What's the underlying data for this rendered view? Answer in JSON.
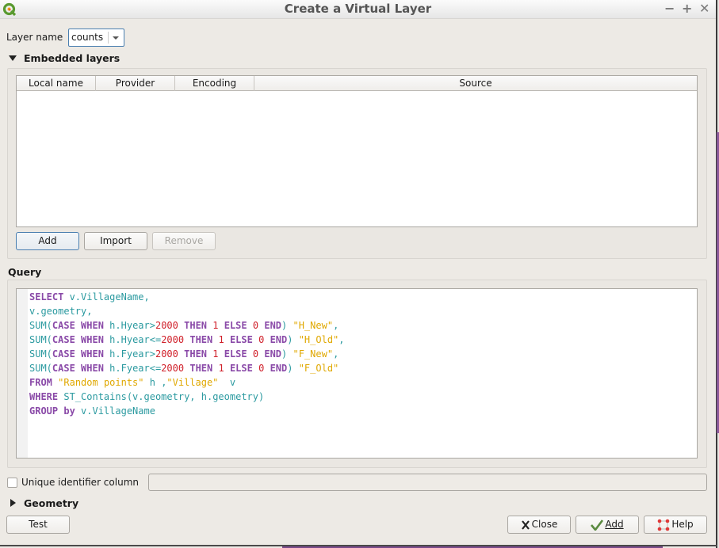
{
  "window": {
    "title": "Create a Virtual Layer",
    "app_icon": "qgis-logo-icon",
    "controls": {
      "minimize": "−",
      "maximize": "+",
      "close": "✕"
    }
  },
  "layer_name": {
    "label": "Layer name",
    "value": "counts"
  },
  "embedded_layers": {
    "title": "Embedded layers",
    "expanded": true,
    "columns": [
      "Local name",
      "Provider",
      "Encoding",
      "Source"
    ],
    "rows": [],
    "buttons": {
      "add": "Add",
      "import": "Import",
      "remove": "Remove"
    }
  },
  "query": {
    "title": "Query",
    "lines": [
      [
        [
          "kw",
          "SELECT"
        ],
        [
          "id",
          " v.VillageName,"
        ]
      ],
      [
        [
          "id",
          "v.geometry,"
        ]
      ],
      [
        [
          "id",
          "SUM("
        ],
        [
          "kw",
          "CASE"
        ],
        [
          "id",
          " "
        ],
        [
          "kw",
          "WHEN"
        ],
        [
          "id",
          " h.Hyear>"
        ],
        [
          "num",
          "2000"
        ],
        [
          "id",
          " "
        ],
        [
          "kw",
          "THEN"
        ],
        [
          "id",
          " "
        ],
        [
          "num",
          "1"
        ],
        [
          "id",
          " "
        ],
        [
          "kw",
          "ELSE"
        ],
        [
          "id",
          " "
        ],
        [
          "num",
          "0"
        ],
        [
          "id",
          " "
        ],
        [
          "kw",
          "END"
        ],
        [
          "id",
          ") "
        ],
        [
          "str",
          "\"H_New\""
        ],
        [
          "id",
          ","
        ]
      ],
      [
        [
          "id",
          "SUM("
        ],
        [
          "kw",
          "CASE"
        ],
        [
          "id",
          " "
        ],
        [
          "kw",
          "WHEN"
        ],
        [
          "id",
          " h.Hyear<="
        ],
        [
          "num",
          "2000"
        ],
        [
          "id",
          " "
        ],
        [
          "kw",
          "THEN"
        ],
        [
          "id",
          " "
        ],
        [
          "num",
          "1"
        ],
        [
          "id",
          " "
        ],
        [
          "kw",
          "ELSE"
        ],
        [
          "id",
          " "
        ],
        [
          "num",
          "0"
        ],
        [
          "id",
          " "
        ],
        [
          "kw",
          "END"
        ],
        [
          "id",
          ") "
        ],
        [
          "str",
          "\"H_Old\""
        ],
        [
          "id",
          ","
        ]
      ],
      [
        [
          "id",
          "SUM("
        ],
        [
          "kw",
          "CASE"
        ],
        [
          "id",
          " "
        ],
        [
          "kw",
          "WHEN"
        ],
        [
          "id",
          " h.Fyear>"
        ],
        [
          "num",
          "2000"
        ],
        [
          "id",
          " "
        ],
        [
          "kw",
          "THEN"
        ],
        [
          "id",
          " "
        ],
        [
          "num",
          "1"
        ],
        [
          "id",
          " "
        ],
        [
          "kw",
          "ELSE"
        ],
        [
          "id",
          " "
        ],
        [
          "num",
          "0"
        ],
        [
          "id",
          " "
        ],
        [
          "kw",
          "END"
        ],
        [
          "id",
          ") "
        ],
        [
          "str",
          "\"F_New\""
        ],
        [
          "id",
          ","
        ]
      ],
      [
        [
          "id",
          "SUM("
        ],
        [
          "kw",
          "CASE"
        ],
        [
          "id",
          " "
        ],
        [
          "kw",
          "WHEN"
        ],
        [
          "id",
          " h.Fyear<="
        ],
        [
          "num",
          "2000"
        ],
        [
          "id",
          " "
        ],
        [
          "kw",
          "THEN"
        ],
        [
          "id",
          " "
        ],
        [
          "num",
          "1"
        ],
        [
          "id",
          " "
        ],
        [
          "kw",
          "ELSE"
        ],
        [
          "id",
          " "
        ],
        [
          "num",
          "0"
        ],
        [
          "id",
          " "
        ],
        [
          "kw",
          "END"
        ],
        [
          "id",
          ") "
        ],
        [
          "str",
          "\"F_Old\""
        ]
      ],
      [
        [
          "kw",
          "FROM"
        ],
        [
          "id",
          " "
        ],
        [
          "str",
          "\"Random points\""
        ],
        [
          "id",
          " h ,"
        ],
        [
          "str",
          "\"Village\""
        ],
        [
          "id",
          "  v"
        ]
      ],
      [
        [
          "kw",
          "WHERE"
        ],
        [
          "id",
          " ST_Contains(v.geometry, h.geometry)"
        ]
      ],
      [
        [
          "kw",
          "GROUP by"
        ],
        [
          "id",
          " v.VillageName"
        ]
      ]
    ],
    "colors": {
      "keyword": "#8a4aa8",
      "identifier": "#2b9aa0",
      "number": "#d0202a",
      "string": "#e0a800"
    }
  },
  "unique_id": {
    "label": "Unique identifier column",
    "checked": false,
    "value": ""
  },
  "geometry": {
    "title": "Geometry",
    "expanded": false
  },
  "footer": {
    "test": "Test",
    "close": "Close",
    "add": "Add",
    "help": "Help"
  }
}
